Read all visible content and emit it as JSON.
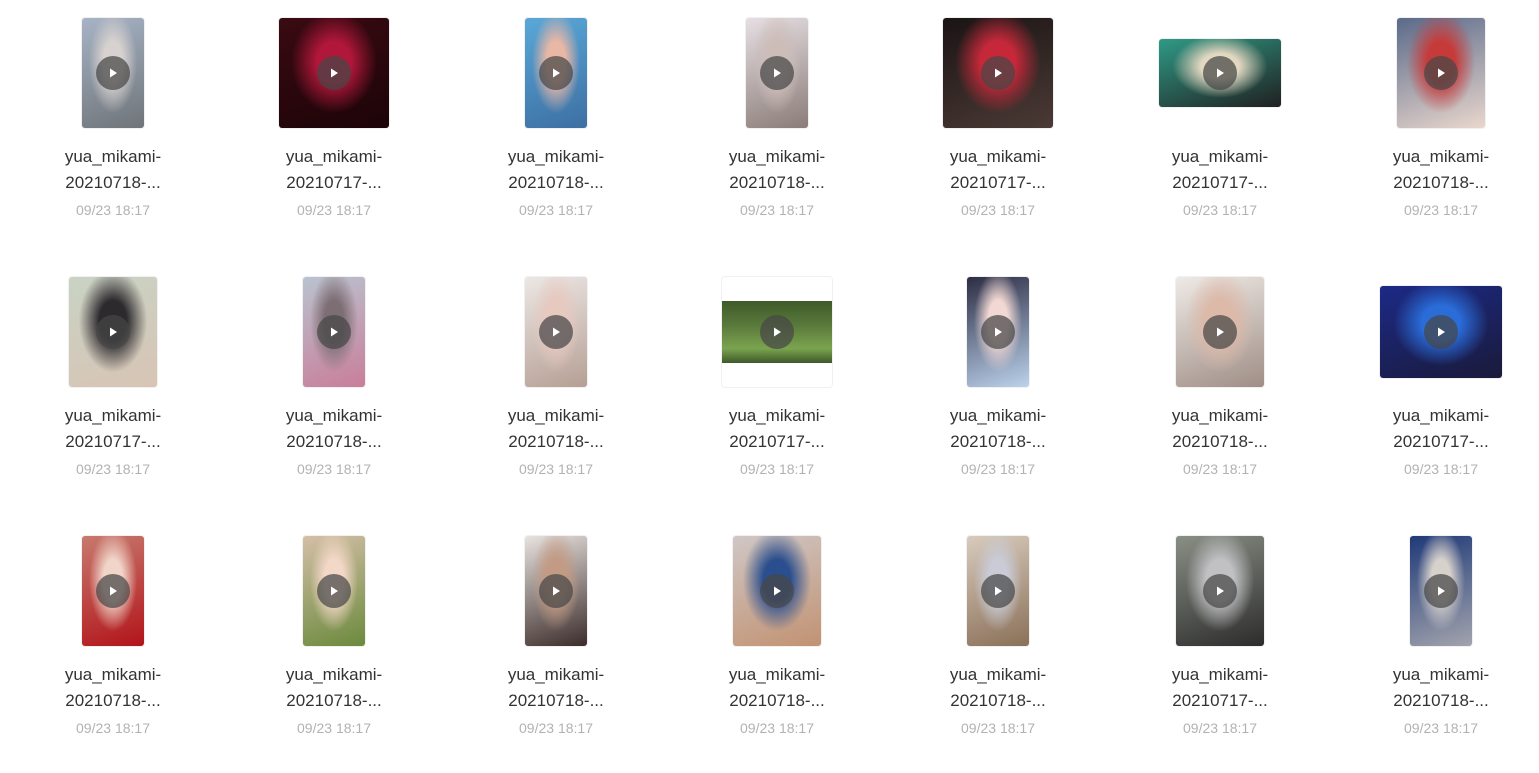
{
  "files": [
    {
      "line1": "yua_mikami-",
      "line2": "20210718-...",
      "date": "09/23 18:17",
      "shape": "portrait",
      "colors": [
        "#a7b4c6",
        "#d7d2cf",
        "#6f7479"
      ]
    },
    {
      "line1": "yua_mikami-",
      "line2": "20210717-...",
      "date": "09/23 18:17",
      "shape": "square",
      "colors": [
        "#3a0a12",
        "#b0173a",
        "#1c0408"
      ]
    },
    {
      "line1": "yua_mikami-",
      "line2": "20210718-...",
      "date": "09/23 18:17",
      "shape": "portrait",
      "colors": [
        "#5aa8d8",
        "#e8b7a6",
        "#3d6fa3"
      ]
    },
    {
      "line1": "yua_mikami-",
      "line2": "20210718-...",
      "date": "09/23 18:17",
      "shape": "portrait",
      "colors": [
        "#e6dfe3",
        "#cdbdb8",
        "#8a7c78"
      ]
    },
    {
      "line1": "yua_mikami-",
      "line2": "20210717-...",
      "date": "09/23 18:17",
      "shape": "square",
      "colors": [
        "#1a1414",
        "#c6283a",
        "#4b3a35"
      ]
    },
    {
      "line1": "yua_mikami-",
      "line2": "20210717-...",
      "date": "09/23 18:17",
      "shape": "landscape",
      "colors": [
        "#2f9a86",
        "#e2d7c1",
        "#202020"
      ]
    },
    {
      "line1": "yua_mikami-",
      "line2": "20210718-...",
      "date": "09/23 18:17",
      "shape": "portrait-wide",
      "colors": [
        "#5a6a8a",
        "#c63a3a",
        "#e9d7cd"
      ]
    },
    {
      "line1": "yua_mikami-",
      "line2": "20210717-...",
      "date": "09/23 18:17",
      "shape": "portrait-wide",
      "colors": [
        "#c9d3c4",
        "#2d2a2e",
        "#d8c4b5"
      ]
    },
    {
      "line1": "yua_mikami-",
      "line2": "20210718-...",
      "date": "09/23 18:17",
      "shape": "portrait",
      "colors": [
        "#b9c3cf",
        "#7d6e74",
        "#c97e9a"
      ]
    },
    {
      "line1": "yua_mikami-",
      "line2": "20210718-...",
      "date": "09/23 18:17",
      "shape": "portrait",
      "colors": [
        "#ece7e5",
        "#e7c9c0",
        "#b69f94"
      ]
    },
    {
      "line1": "yua_mikami-",
      "line2": "20210717-...",
      "date": "09/23 18:17",
      "shape": "letterbox",
      "colors": [
        "#5b7b3c",
        "#7ba44f",
        "#3e5a2a"
      ]
    },
    {
      "line1": "yua_mikami-",
      "line2": "20210718-...",
      "date": "09/23 18:17",
      "shape": "portrait",
      "colors": [
        "#2c2d44",
        "#f2d8d3",
        "#bcd2ec"
      ]
    },
    {
      "line1": "yua_mikami-",
      "line2": "20210718-...",
      "date": "09/23 18:17",
      "shape": "portrait-wide",
      "colors": [
        "#efeae6",
        "#dcb9a8",
        "#9f8e86"
      ]
    },
    {
      "line1": "yua_mikami-",
      "line2": "20210717-...",
      "date": "09/23 18:17",
      "shape": "landscape-tall",
      "colors": [
        "#1c2a86",
        "#2a6cd8",
        "#1a1a3a"
      ]
    },
    {
      "line1": "yua_mikami-",
      "line2": "20210718-...",
      "date": "09/23 18:17",
      "shape": "portrait",
      "colors": [
        "#c77a6e",
        "#f1d5c9",
        "#b2141a"
      ]
    },
    {
      "line1": "yua_mikami-",
      "line2": "20210718-...",
      "date": "09/23 18:17",
      "shape": "portrait",
      "colors": [
        "#d4bfa6",
        "#f3d8c8",
        "#6b8a3d"
      ]
    },
    {
      "line1": "yua_mikami-",
      "line2": "20210718-...",
      "date": "09/23 18:17",
      "shape": "portrait",
      "colors": [
        "#e8e3df",
        "#c39a84",
        "#3b2c2a"
      ]
    },
    {
      "line1": "yua_mikami-",
      "line2": "20210718-...",
      "date": "09/23 18:17",
      "shape": "portrait-wide",
      "colors": [
        "#cfc7c5",
        "#2b4f8e",
        "#c29272"
      ]
    },
    {
      "line1": "yua_mikami-",
      "line2": "20210718-...",
      "date": "09/23 18:17",
      "shape": "portrait",
      "colors": [
        "#d8cbbd",
        "#c9cbd6",
        "#8a7058"
      ]
    },
    {
      "line1": "yua_mikami-",
      "line2": "20210717-...",
      "date": "09/23 18:17",
      "shape": "portrait-wide",
      "colors": [
        "#8a8f85",
        "#c1c1c4",
        "#2c2c2c"
      ]
    },
    {
      "line1": "yua_mikami-",
      "line2": "20210718-...",
      "date": "09/23 18:17",
      "shape": "portrait",
      "colors": [
        "#1f3a78",
        "#d7d1cc",
        "#a2a3ad"
      ]
    }
  ]
}
